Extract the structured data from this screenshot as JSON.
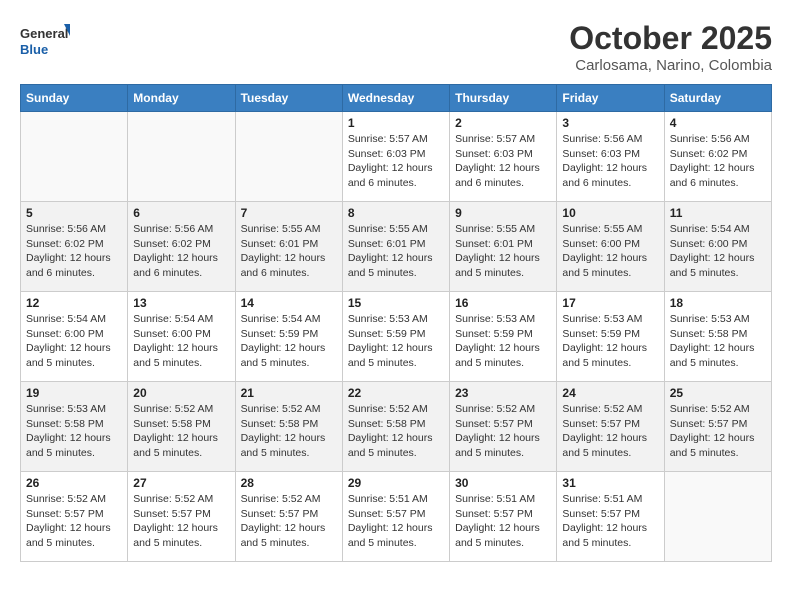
{
  "logo": {
    "line1": "General",
    "line2": "Blue"
  },
  "title": "October 2025",
  "location": "Carlosama, Narino, Colombia",
  "weekdays": [
    "Sunday",
    "Monday",
    "Tuesday",
    "Wednesday",
    "Thursday",
    "Friday",
    "Saturday"
  ],
  "weeks": [
    [
      {
        "day": "",
        "info": ""
      },
      {
        "day": "",
        "info": ""
      },
      {
        "day": "",
        "info": ""
      },
      {
        "day": "1",
        "info": "Sunrise: 5:57 AM\nSunset: 6:03 PM\nDaylight: 12 hours\nand 6 minutes."
      },
      {
        "day": "2",
        "info": "Sunrise: 5:57 AM\nSunset: 6:03 PM\nDaylight: 12 hours\nand 6 minutes."
      },
      {
        "day": "3",
        "info": "Sunrise: 5:56 AM\nSunset: 6:03 PM\nDaylight: 12 hours\nand 6 minutes."
      },
      {
        "day": "4",
        "info": "Sunrise: 5:56 AM\nSunset: 6:02 PM\nDaylight: 12 hours\nand 6 minutes."
      }
    ],
    [
      {
        "day": "5",
        "info": "Sunrise: 5:56 AM\nSunset: 6:02 PM\nDaylight: 12 hours\nand 6 minutes."
      },
      {
        "day": "6",
        "info": "Sunrise: 5:56 AM\nSunset: 6:02 PM\nDaylight: 12 hours\nand 6 minutes."
      },
      {
        "day": "7",
        "info": "Sunrise: 5:55 AM\nSunset: 6:01 PM\nDaylight: 12 hours\nand 6 minutes."
      },
      {
        "day": "8",
        "info": "Sunrise: 5:55 AM\nSunset: 6:01 PM\nDaylight: 12 hours\nand 5 minutes."
      },
      {
        "day": "9",
        "info": "Sunrise: 5:55 AM\nSunset: 6:01 PM\nDaylight: 12 hours\nand 5 minutes."
      },
      {
        "day": "10",
        "info": "Sunrise: 5:55 AM\nSunset: 6:00 PM\nDaylight: 12 hours\nand 5 minutes."
      },
      {
        "day": "11",
        "info": "Sunrise: 5:54 AM\nSunset: 6:00 PM\nDaylight: 12 hours\nand 5 minutes."
      }
    ],
    [
      {
        "day": "12",
        "info": "Sunrise: 5:54 AM\nSunset: 6:00 PM\nDaylight: 12 hours\nand 5 minutes."
      },
      {
        "day": "13",
        "info": "Sunrise: 5:54 AM\nSunset: 6:00 PM\nDaylight: 12 hours\nand 5 minutes."
      },
      {
        "day": "14",
        "info": "Sunrise: 5:54 AM\nSunset: 5:59 PM\nDaylight: 12 hours\nand 5 minutes."
      },
      {
        "day": "15",
        "info": "Sunrise: 5:53 AM\nSunset: 5:59 PM\nDaylight: 12 hours\nand 5 minutes."
      },
      {
        "day": "16",
        "info": "Sunrise: 5:53 AM\nSunset: 5:59 PM\nDaylight: 12 hours\nand 5 minutes."
      },
      {
        "day": "17",
        "info": "Sunrise: 5:53 AM\nSunset: 5:59 PM\nDaylight: 12 hours\nand 5 minutes."
      },
      {
        "day": "18",
        "info": "Sunrise: 5:53 AM\nSunset: 5:58 PM\nDaylight: 12 hours\nand 5 minutes."
      }
    ],
    [
      {
        "day": "19",
        "info": "Sunrise: 5:53 AM\nSunset: 5:58 PM\nDaylight: 12 hours\nand 5 minutes."
      },
      {
        "day": "20",
        "info": "Sunrise: 5:52 AM\nSunset: 5:58 PM\nDaylight: 12 hours\nand 5 minutes."
      },
      {
        "day": "21",
        "info": "Sunrise: 5:52 AM\nSunset: 5:58 PM\nDaylight: 12 hours\nand 5 minutes."
      },
      {
        "day": "22",
        "info": "Sunrise: 5:52 AM\nSunset: 5:58 PM\nDaylight: 12 hours\nand 5 minutes."
      },
      {
        "day": "23",
        "info": "Sunrise: 5:52 AM\nSunset: 5:57 PM\nDaylight: 12 hours\nand 5 minutes."
      },
      {
        "day": "24",
        "info": "Sunrise: 5:52 AM\nSunset: 5:57 PM\nDaylight: 12 hours\nand 5 minutes."
      },
      {
        "day": "25",
        "info": "Sunrise: 5:52 AM\nSunset: 5:57 PM\nDaylight: 12 hours\nand 5 minutes."
      }
    ],
    [
      {
        "day": "26",
        "info": "Sunrise: 5:52 AM\nSunset: 5:57 PM\nDaylight: 12 hours\nand 5 minutes."
      },
      {
        "day": "27",
        "info": "Sunrise: 5:52 AM\nSunset: 5:57 PM\nDaylight: 12 hours\nand 5 minutes."
      },
      {
        "day": "28",
        "info": "Sunrise: 5:52 AM\nSunset: 5:57 PM\nDaylight: 12 hours\nand 5 minutes."
      },
      {
        "day": "29",
        "info": "Sunrise: 5:51 AM\nSunset: 5:57 PM\nDaylight: 12 hours\nand 5 minutes."
      },
      {
        "day": "30",
        "info": "Sunrise: 5:51 AM\nSunset: 5:57 PM\nDaylight: 12 hours\nand 5 minutes."
      },
      {
        "day": "31",
        "info": "Sunrise: 5:51 AM\nSunset: 5:57 PM\nDaylight: 12 hours\nand 5 minutes."
      },
      {
        "day": "",
        "info": ""
      }
    ]
  ]
}
